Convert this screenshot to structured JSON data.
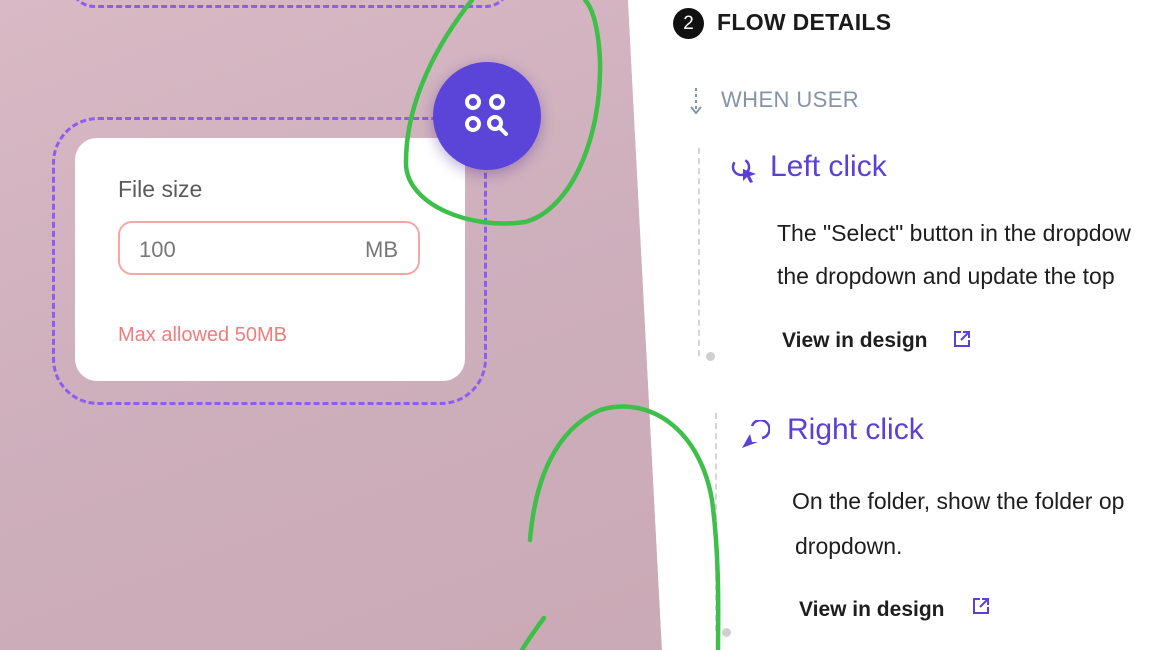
{
  "canvas": {
    "card": {
      "label": "File size",
      "value": "100",
      "unit": "MB",
      "error": "Max allowed 50MB"
    },
    "fab_icon": "grid-search-icon",
    "colors": {
      "accent": "#5b45d8",
      "dashed": "#8f5cf2",
      "error": "#f07d7d",
      "background": "#cdaebb"
    }
  },
  "panel": {
    "step_number": "2",
    "section_title": "FLOW DETAILS",
    "when_label": "WHEN USER",
    "actions": [
      {
        "title": "Left click",
        "icon": "cursor-click-icon",
        "desc_line1": "The \"Select\" button in the dropdow",
        "desc_line2": "the dropdown and update the top",
        "link": "View in design"
      },
      {
        "title": "Right click",
        "icon": "pointer-right-click-icon",
        "desc_line1": "On the folder, show the folder op",
        "desc_line2": "dropdown.",
        "link": "View in design"
      }
    ],
    "colors": {
      "action_title": "#5b3fd6",
      "muted": "#8593a8"
    }
  },
  "annotations": {
    "scribble_color": "#3dbf4a"
  }
}
